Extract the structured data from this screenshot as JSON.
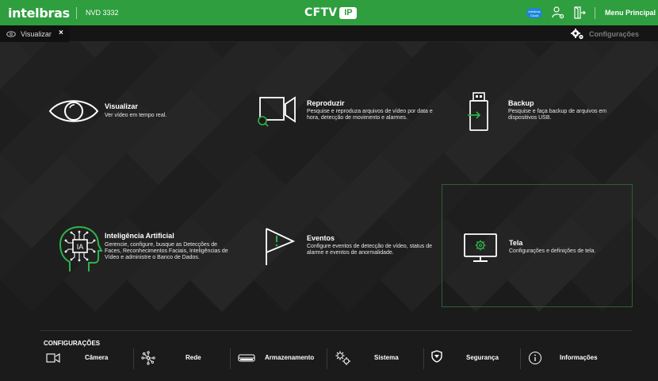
{
  "topbar": {
    "logo": "intelbras",
    "model": "NVD 3332",
    "center_title": "CFTV",
    "center_badge": "IP",
    "cloud_badge_line1": "Intelbras",
    "cloud_badge_line2": "Cloud",
    "menu_label": "Menu Principal",
    "accent_color": "#2e9e3e"
  },
  "tabbar": {
    "active_tab": "Visualizar",
    "close_glyph": "×",
    "config_label": "Configurações"
  },
  "tiles": [
    {
      "title": "Visualizar",
      "description": "Ver vídeo em tempo real.",
      "icon": "eye-icon"
    },
    {
      "title": "Reproduzir",
      "description": "Pesquise e reproduza arquivos de vídeo por data e hora, detecção de movimento e alarmes.",
      "icon": "playback-icon"
    },
    {
      "title": "Backup",
      "description": "Pesquise e faça backup de arquivos em dispositivos USB.",
      "icon": "usb-icon"
    },
    {
      "title": "Inteligência Artificial",
      "description": "Gerencie, configure, busque as Detecções de Faces, Reconhecimentos Faciais, Inteligências de Vídeo e administre o Banco de Dados.",
      "icon": "ai-head-icon",
      "icon_text": "IA"
    },
    {
      "title": "Eventos",
      "description": "Configure eventos de detecção de vídeo, status de alarme e eventos de anormalidade.",
      "icon": "flag-icon"
    },
    {
      "title": "Tela",
      "description": "Configurações e definições de tela.",
      "icon": "monitor-icon"
    }
  ],
  "configuracoes": {
    "heading": "CONFIGURAÇÕES",
    "items": [
      {
        "label": "Câmera",
        "icon": "camera-icon"
      },
      {
        "label": "Rede",
        "icon": "network-icon"
      },
      {
        "label": "Armazenamento",
        "icon": "storage-icon"
      },
      {
        "label": "Sistema",
        "icon": "gears-icon"
      },
      {
        "label": "Segurança",
        "icon": "shield-icon"
      },
      {
        "label": "Informações",
        "icon": "info-icon"
      }
    ]
  }
}
